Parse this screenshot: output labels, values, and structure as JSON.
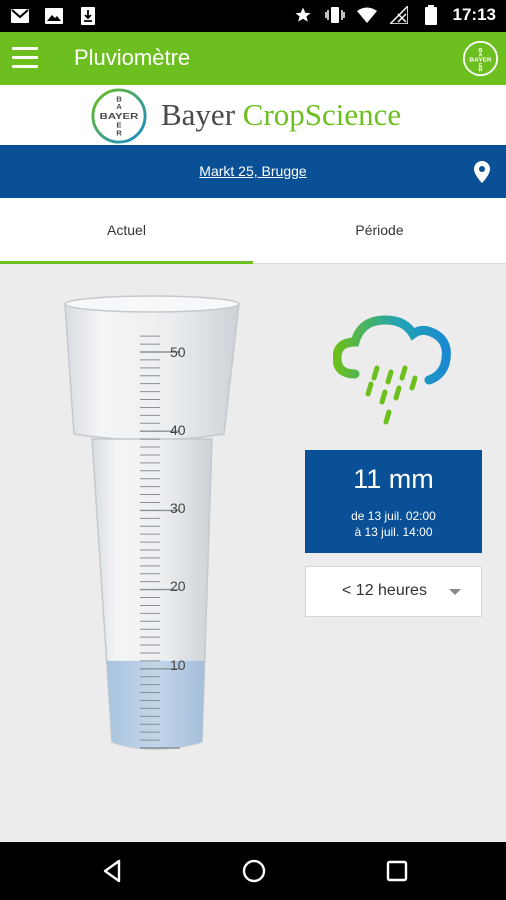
{
  "status_bar": {
    "time": "17:13",
    "left_icons": [
      "gmail-icon",
      "image-icon",
      "download-icon"
    ],
    "right_icons": [
      "star-icon",
      "vibrate-icon",
      "wifi-icon",
      "no-signal-icon",
      "battery-icon"
    ]
  },
  "app_bar": {
    "title": "Pluviomètre",
    "logo_text": "BAYER"
  },
  "brand": {
    "logo_text": "BAYER",
    "name_part1": "Bayer ",
    "name_part2": "CropScience"
  },
  "location": {
    "address": "Markt 25, Brugge"
  },
  "tabs": [
    {
      "label": "Actuel",
      "active": true
    },
    {
      "label": "Période",
      "active": false
    }
  ],
  "gauge": {
    "scale_labels": [
      "50",
      "40",
      "30",
      "20",
      "10"
    ],
    "fill_mm": 11,
    "max_mm": 50
  },
  "rain": {
    "value": "11 mm",
    "from": "de 13 juil. 02:00",
    "to": "à 13 juil. 14:00"
  },
  "period_select": {
    "value": "< 12 heures"
  },
  "colors": {
    "green": "#6cbf1e",
    "blue": "#0a5096"
  }
}
